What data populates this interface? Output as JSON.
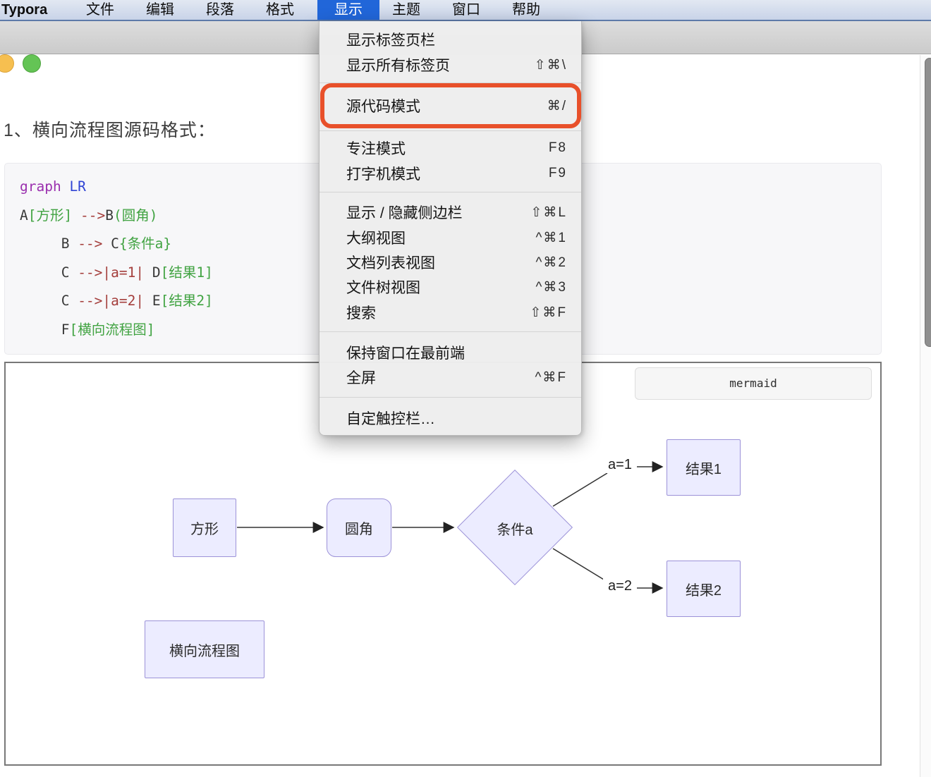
{
  "menubar": {
    "selected_bg": "#2166d9",
    "items": [
      {
        "label": "Typora"
      },
      {
        "label": "文件"
      },
      {
        "label": "编辑"
      },
      {
        "label": "段落"
      },
      {
        "label": "格式"
      },
      {
        "label": "显示",
        "selected": true
      },
      {
        "label": "主题"
      },
      {
        "label": "窗口"
      },
      {
        "label": "帮助"
      }
    ]
  },
  "view_menu": {
    "annotation_color": "#e8502a",
    "items": [
      {
        "label": "显示标签页栏",
        "shortcut": ""
      },
      {
        "label": "显示所有标签页",
        "shortcut": "⇧⌘\\"
      },
      {
        "label": "源代码模式",
        "shortcut": "⌘/",
        "highlighted": true
      },
      {
        "label": "专注模式",
        "shortcut": "F8"
      },
      {
        "label": "打字机模式",
        "shortcut": "F9"
      },
      {
        "label": "显示 / 隐藏侧边栏",
        "shortcut": "⇧⌘L"
      },
      {
        "label": "大纲视图",
        "shortcut": "^⌘1"
      },
      {
        "label": "文档列表视图",
        "shortcut": "^⌘2"
      },
      {
        "label": "文件树视图",
        "shortcut": "^⌘3"
      },
      {
        "label": "搜索",
        "shortcut": "⇧⌘F"
      },
      {
        "label": "保持窗口在最前端",
        "shortcut": ""
      },
      {
        "label": "全屏",
        "shortcut": "^⌘F"
      },
      {
        "label": "自定触控栏…",
        "shortcut": ""
      }
    ]
  },
  "document": {
    "heading": "1、横向流程图源码格式：",
    "code": {
      "lines": [
        {
          "segments": [
            {
              "t": "graph",
              "c": "#9a2fae"
            },
            {
              "t": " LR",
              "c": "#2f43d4"
            }
          ]
        },
        {
          "segments": [
            {
              "t": "A",
              "c": "#383838"
            },
            {
              "t": "[方形]",
              "c": "#41a342"
            },
            {
              "t": " ",
              "c": "#383838"
            },
            {
              "t": "-->",
              "c": "#a43e3c"
            },
            {
              "t": "B",
              "c": "#383838"
            },
            {
              "t": "(圆角)",
              "c": "#41a342"
            }
          ]
        },
        {
          "segments": [
            {
              "t": "     B ",
              "c": "#383838"
            },
            {
              "t": "--> ",
              "c": "#a43e3c"
            },
            {
              "t": "C",
              "c": "#383838"
            },
            {
              "t": "{条件a}",
              "c": "#41a342"
            }
          ]
        },
        {
          "segments": [
            {
              "t": "     C ",
              "c": "#383838"
            },
            {
              "t": "-->|a=1|",
              "c": "#a43e3c"
            },
            {
              "t": " D",
              "c": "#383838"
            },
            {
              "t": "[结果1]",
              "c": "#41a342"
            }
          ]
        },
        {
          "segments": [
            {
              "t": "     C ",
              "c": "#383838"
            },
            {
              "t": "-->|a=2|",
              "c": "#a43e3c"
            },
            {
              "t": " E",
              "c": "#383838"
            },
            {
              "t": "[结果2]",
              "c": "#41a342"
            }
          ]
        },
        {
          "segments": [
            {
              "t": "     F",
              "c": "#383838"
            },
            {
              "t": "[横向流程图]",
              "c": "#41a342"
            }
          ]
        }
      ]
    }
  },
  "diagram": {
    "badge": "mermaid",
    "node_fill": "#ececff",
    "node_border": "#9c92d8",
    "nodes": [
      {
        "id": "A",
        "label": "方形",
        "shape": "rect"
      },
      {
        "id": "B",
        "label": "圆角",
        "shape": "rounded"
      },
      {
        "id": "C",
        "label": "条件a",
        "shape": "diamond"
      },
      {
        "id": "D",
        "label": "结果1",
        "shape": "rect"
      },
      {
        "id": "E",
        "label": "结果2",
        "shape": "rect"
      },
      {
        "id": "F",
        "label": "横向流程图",
        "shape": "rect"
      }
    ],
    "edges": [
      {
        "from": "A",
        "to": "B",
        "label": ""
      },
      {
        "from": "B",
        "to": "C",
        "label": ""
      },
      {
        "from": "C",
        "to": "D",
        "label": "a=1"
      },
      {
        "from": "C",
        "to": "E",
        "label": "a=2"
      }
    ]
  }
}
